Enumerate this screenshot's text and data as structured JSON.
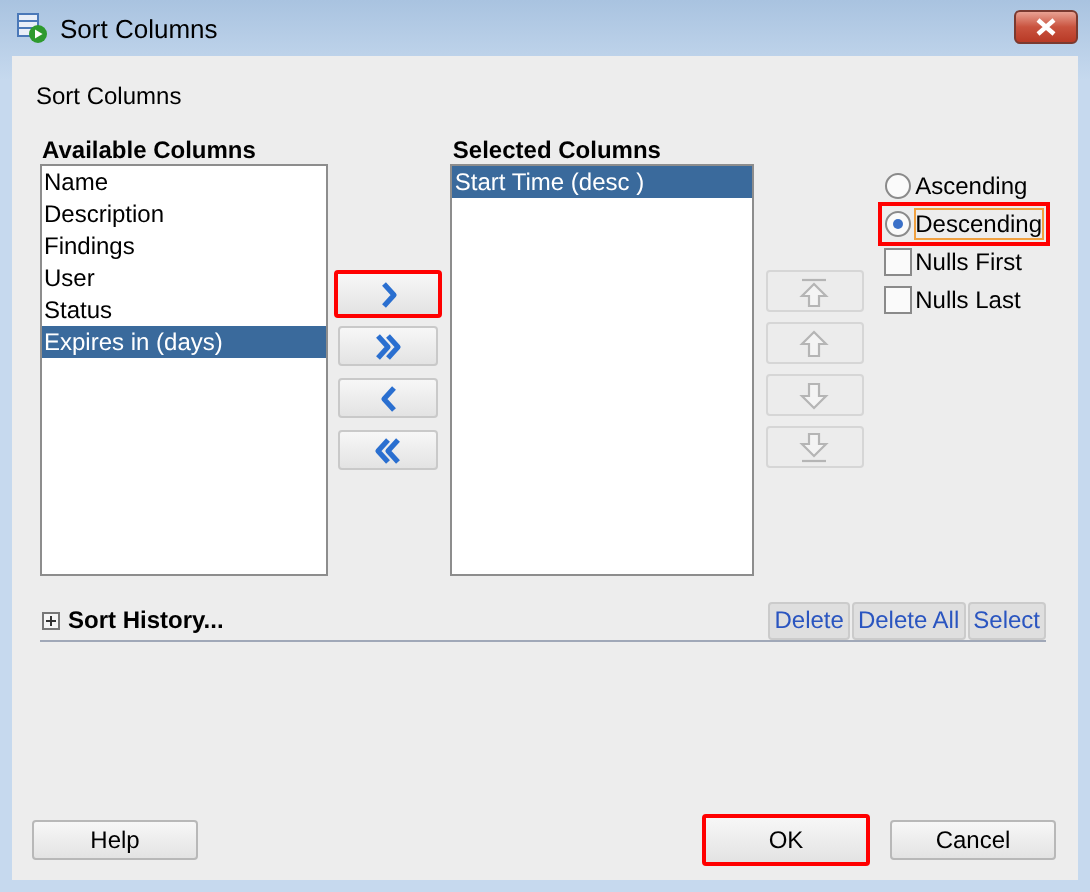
{
  "window": {
    "title": "Sort Columns"
  },
  "heading": "Sort Columns",
  "available_columns": {
    "label": "Available Columns",
    "items": [
      {
        "label": "Name",
        "selected": false
      },
      {
        "label": "Description",
        "selected": false
      },
      {
        "label": "Findings",
        "selected": false
      },
      {
        "label": "User",
        "selected": false
      },
      {
        "label": "Status",
        "selected": false
      },
      {
        "label": "Expires in (days)",
        "selected": true
      }
    ]
  },
  "move_buttons": [
    {
      "kind": "add",
      "highlighted": true
    },
    {
      "kind": "add_all",
      "highlighted": false
    },
    {
      "kind": "remove",
      "highlighted": false
    },
    {
      "kind": "remove_all",
      "highlighted": false
    }
  ],
  "selected_columns": {
    "label": "Selected Columns",
    "items": [
      {
        "label": "Start Time (desc )",
        "selected": true
      }
    ]
  },
  "order_buttons": [
    {
      "kind": "top",
      "disabled": true
    },
    {
      "kind": "up",
      "disabled": true
    },
    {
      "kind": "down",
      "disabled": true
    },
    {
      "kind": "bottom",
      "disabled": true
    }
  ],
  "sort_options": [
    {
      "kind": "radio",
      "label": "Ascending",
      "checked": false,
      "highlighted": false
    },
    {
      "kind": "radio",
      "label": "Descending",
      "checked": true,
      "highlighted": true
    },
    {
      "kind": "checkbox",
      "label": "Nulls First",
      "checked": false,
      "highlighted": false
    },
    {
      "kind": "checkbox",
      "label": "Nulls Last",
      "checked": false,
      "highlighted": false
    }
  ],
  "sort_history": {
    "label": "Sort History...",
    "expanded": false,
    "buttons": [
      "Delete",
      "Delete All",
      "Select"
    ]
  },
  "footer_buttons": [
    {
      "label": "Help",
      "highlighted": false
    },
    {
      "label": "OK",
      "highlighted": true
    },
    {
      "label": "Cancel",
      "highlighted": false
    }
  ]
}
